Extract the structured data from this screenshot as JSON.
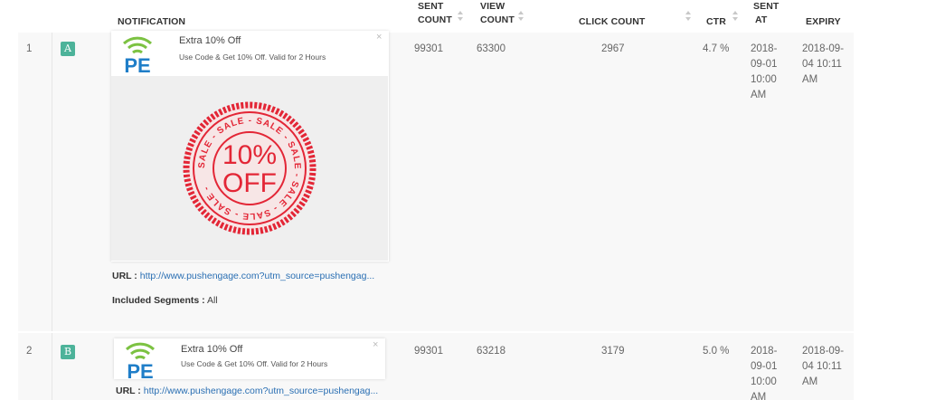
{
  "columns": {
    "notification": "NOTIFICATION",
    "sent_count_1": "SENT",
    "sent_count_2": "COUNT",
    "view_count_1": "VIEW",
    "view_count_2": "COUNT",
    "click_count": "CLICK COUNT",
    "ctr": "CTR",
    "sent_at_1": "SENT",
    "sent_at_2": "AT",
    "expiry": "EXPIRY"
  },
  "rows": [
    {
      "index": "1",
      "variant": "A",
      "notification": {
        "title": "Extra 10% Off",
        "body": "Use Code & Get 10% Off. Valid for 2 Hours",
        "close": "×",
        "brand": "PE",
        "stamp_ring_text": "SALE - SALE - SALE - SALE - SALE - SALE - SALE - ",
        "stamp_line1": "10%",
        "stamp_line2": "OFF"
      },
      "url_label": "URL :",
      "url": "http://www.pushengage.com?utm_source=pushengag...",
      "segments_label": "Included Segments :",
      "segments_value": "All",
      "sent_count": "99301",
      "view_count": "63300",
      "click_count": "2967",
      "ctr": "4.7 %",
      "sent_at": [
        "2018-",
        "09-01",
        "10:00",
        "AM"
      ],
      "expiry": [
        "2018-09-",
        "04 10:11",
        "AM"
      ]
    },
    {
      "index": "2",
      "variant": "B",
      "notification": {
        "title": "Extra 10% Off",
        "body": "Use Code & Get 10% Off. Valid for 2 Hours",
        "close": "×",
        "brand": "PE"
      },
      "url_label": "URL :",
      "url": "http://www.pushengage.com?utm_source=pushengag...",
      "sent_count": "99301",
      "view_count": "63218",
      "click_count": "3179",
      "ctr": "5.0 %",
      "sent_at": [
        "2018-",
        "09-01",
        "10:00",
        "AM"
      ],
      "expiry": [
        "2018-09-",
        "04 10:11",
        "AM"
      ]
    }
  ],
  "icons": {
    "sort": "sort-icon",
    "close": "close-icon",
    "logo": "pushengage-logo-icon",
    "stamp": "sale-stamp-icon"
  },
  "colors": {
    "variant_badge": "#4db39a",
    "logo_green": "#7cc242",
    "logo_blue": "#1f7ec8",
    "stamp_red": "#e32636",
    "link": "#2a6fb3"
  }
}
